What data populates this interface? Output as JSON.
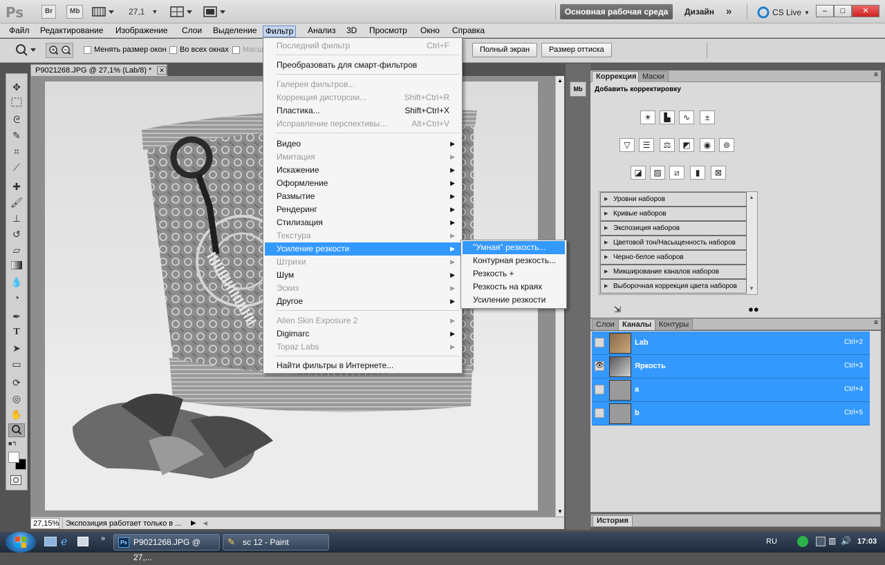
{
  "appbar": {
    "logo": "Ps",
    "br_button": "Br",
    "mb_button": "Mb",
    "zoom": "27,1",
    "workspace": "Основная рабочая среда",
    "design": "Дизайн",
    "more": "»",
    "cs_live": "CS Live",
    "win_min": "–",
    "win_max": "□",
    "win_close": "✕"
  },
  "menubar": {
    "items": [
      "Файл",
      "Редактирование",
      "Изображение",
      "Слои",
      "Выделение",
      "Фильтр",
      "Анализ",
      "3D",
      "Просмотр",
      "Окно",
      "Справка"
    ],
    "active": "Фильтр"
  },
  "options": {
    "resize_windows": "Менять размер окон",
    "all_windows": "Во всех окнах",
    "scale_partial": "Масшт",
    "fullscreen": "Полный экран",
    "print_size": "Размер оттиска"
  },
  "document": {
    "tab_title": "P9021268.JPG @ 27,1% (Lab/8) *",
    "tab_close": "✕",
    "zoom_status": "27,15%",
    "status_text": "Экспозиция работает только в ..."
  },
  "filter_menu": {
    "last_filter": "Последний фильтр",
    "last_filter_key": "Ctrl+F",
    "convert_smart": "Преобразовать для смарт-фильтров",
    "gallery": "Галерея фильтров...",
    "lens_correction": "Коррекция дисторсии...",
    "lens_correction_key": "Shift+Ctrl+R",
    "liquify": "Пластика...",
    "liquify_key": "Shift+Ctrl+X",
    "vanishing": "Исправление перспективы...",
    "vanishing_key": "Alt+Ctrl+V",
    "groups": [
      {
        "label": "Видео",
        "disabled": false
      },
      {
        "label": "Имитация",
        "disabled": true
      },
      {
        "label": "Искажение",
        "disabled": false
      },
      {
        "label": "Оформление",
        "disabled": false
      },
      {
        "label": "Размытие",
        "disabled": false
      },
      {
        "label": "Рендеринг",
        "disabled": false
      },
      {
        "label": "Стилизация",
        "disabled": false
      },
      {
        "label": "Текстура",
        "disabled": true
      },
      {
        "label": "Усиление резкости",
        "disabled": false,
        "highlighted": true
      },
      {
        "label": "Штрихи",
        "disabled": true
      },
      {
        "label": "Шум",
        "disabled": false
      },
      {
        "label": "Эскиз",
        "disabled": true
      },
      {
        "label": "Другое",
        "disabled": false
      }
    ],
    "plugins": [
      {
        "label": "Alien Skin Exposure 2",
        "disabled": true
      },
      {
        "label": "Digimarc",
        "disabled": false
      },
      {
        "label": "Topaz Labs",
        "disabled": true
      }
    ],
    "find_online": "Найти фильтры в Интернете..."
  },
  "sharpen_submenu": {
    "items": [
      "\"Умная\" резкость...",
      "Контурная резкость...",
      "Резкость +",
      "Резкость на краях",
      "Усиление резкости"
    ]
  },
  "adjustments_panel": {
    "tab_correction": "Коррекция",
    "tab_masks": "Маски",
    "heading": "Добавить корректировку",
    "presets": [
      "Уровни наборов",
      "Кривые наборов",
      "Экспозиция наборов",
      "Цветовой тон/Насыщенность наборов",
      "Черно-белое наборов",
      "Микширование каналов наборов",
      "Выборочная коррекция цвета наборов"
    ]
  },
  "channels_panel": {
    "tab_layers": "Слои",
    "tab_channels": "Каналы",
    "tab_paths": "Контуры",
    "channels": [
      {
        "name": "Lab",
        "key": "Ctrl+2",
        "visible": false
      },
      {
        "name": "Яркость",
        "key": "Ctrl+3",
        "visible": true
      },
      {
        "name": "a",
        "key": "Ctrl+4",
        "visible": false
      },
      {
        "name": "b",
        "key": "Ctrl+5",
        "visible": false
      }
    ]
  },
  "history_panel": {
    "title": "История"
  },
  "dock": {
    "mb": "Mb"
  },
  "taskbar": {
    "task_ps": "P9021268.JPG @ 27,...",
    "task_paint": "sc 12 - Paint",
    "lang": "RU",
    "time": "17:03"
  }
}
